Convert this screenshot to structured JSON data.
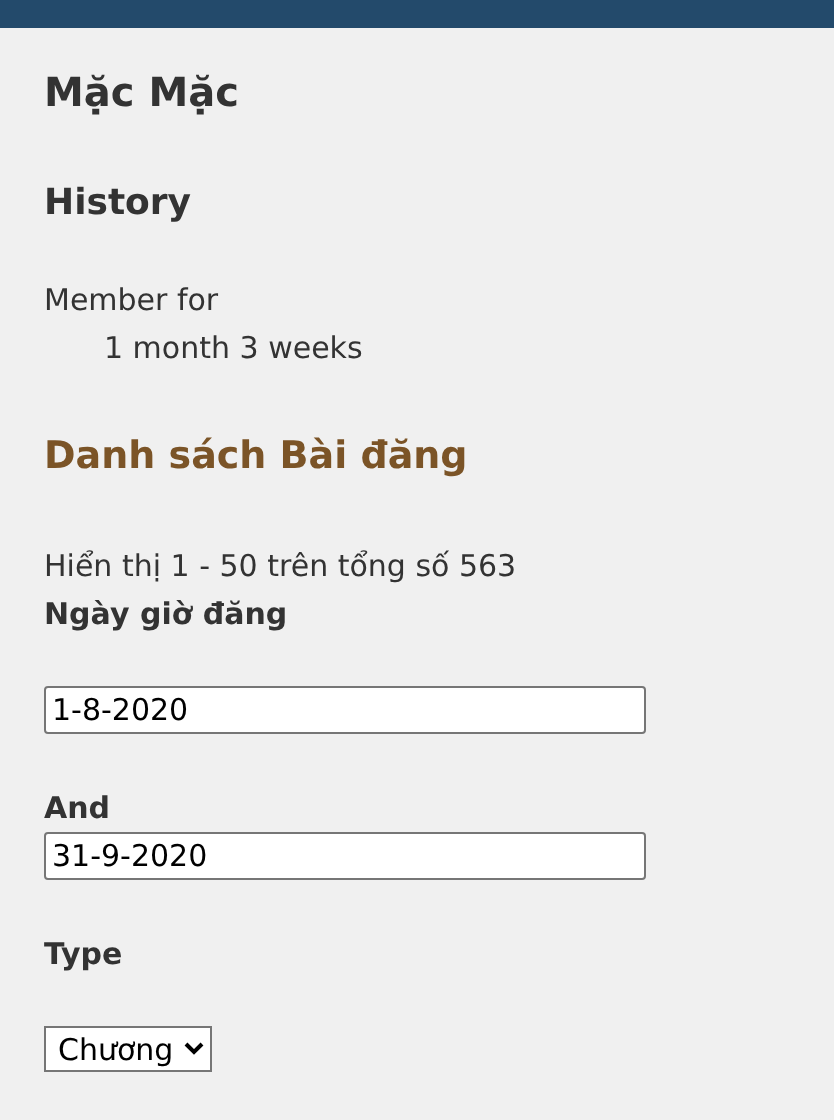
{
  "page_title": "Mặc Mặc",
  "history": {
    "heading": "History",
    "label": "Member for",
    "value": "1 month 3 weeks"
  },
  "posts": {
    "heading": "Danh sách Bài đăng",
    "summary": "Hiển thị 1 - 50 trên tổng số 563",
    "date_label": "Ngày giờ đăng",
    "from_value": "1-8-2020",
    "and_label": "And",
    "to_value": "31-9-2020",
    "type_label": "Type",
    "type_value": "Chương"
  }
}
